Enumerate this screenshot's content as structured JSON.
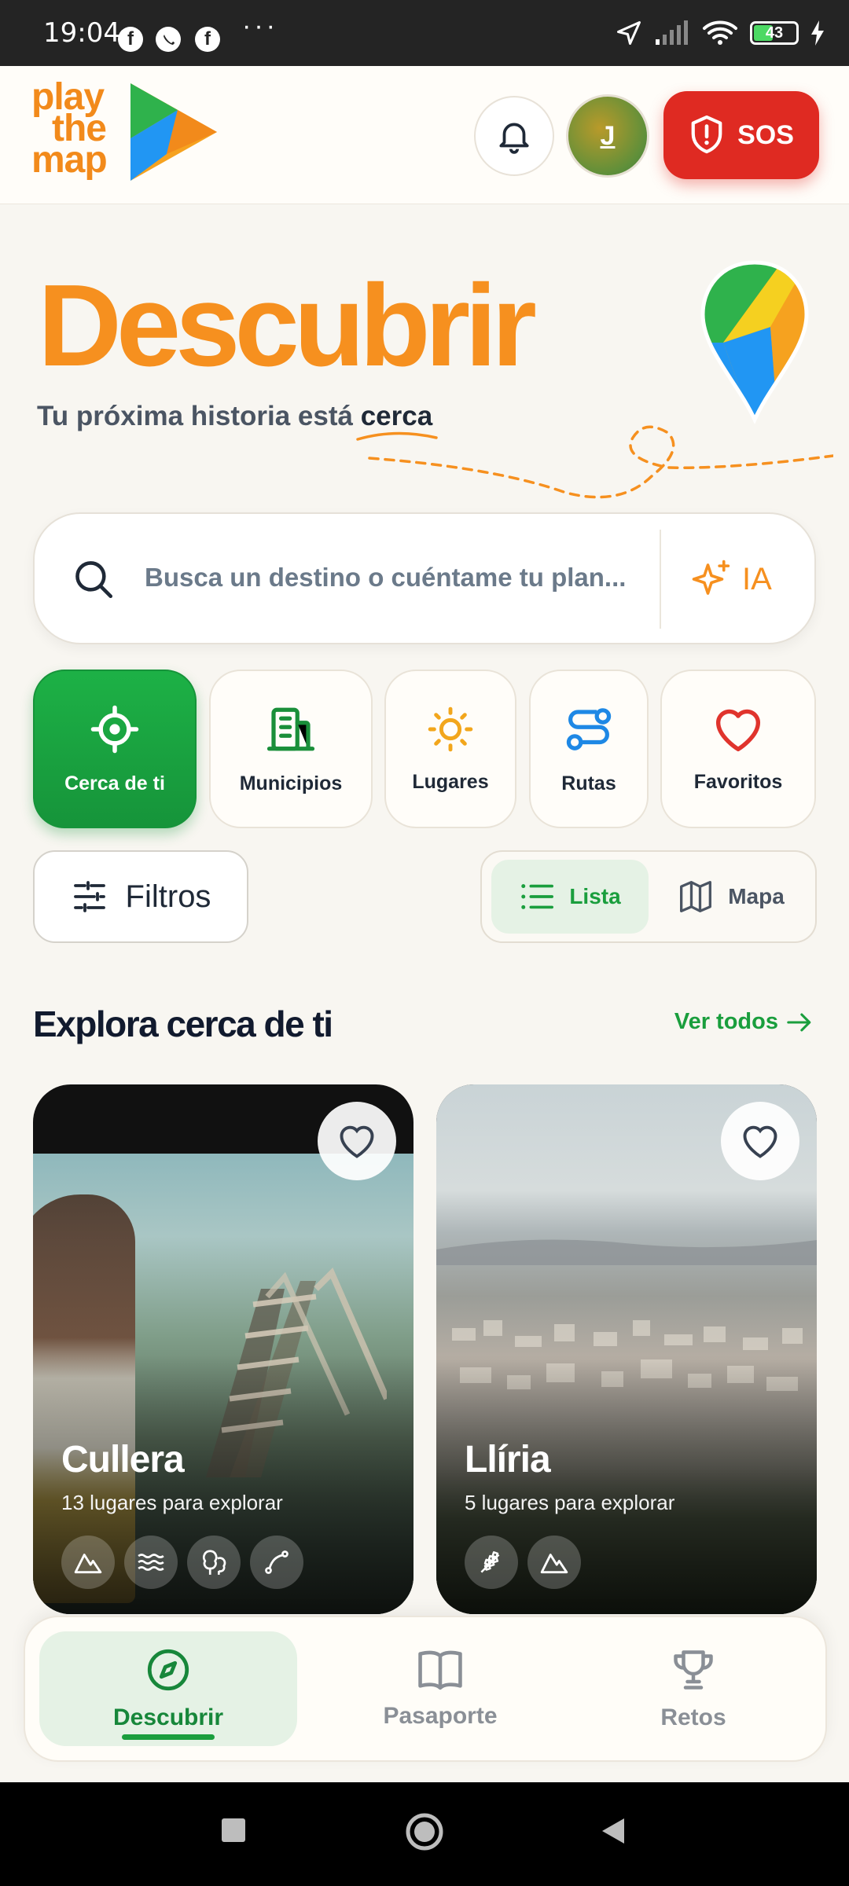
{
  "status_bar": {
    "time": "19:04",
    "battery": "43",
    "apps": [
      "facebook-icon",
      "whatsapp-icon",
      "facebook-icon"
    ],
    "more": "···"
  },
  "header": {
    "logo_lines": [
      "play",
      "the",
      "map"
    ],
    "avatar_initial": "J",
    "sos_label": "SOS"
  },
  "hero": {
    "title": "Descubrir",
    "subtitle_prefix": "Tu próxima historia está ",
    "subtitle_accent": "cerca"
  },
  "search": {
    "placeholder": "Busca un destino o cuéntame tu plan...",
    "ai_label": "IA"
  },
  "categories": [
    {
      "label": "Cerca de ti",
      "icon": "target-icon",
      "active": true
    },
    {
      "label": "Municipios",
      "icon": "building-icon",
      "active": false
    },
    {
      "label": "Lugares",
      "icon": "sun-icon",
      "active": false
    },
    {
      "label": "Rutas",
      "icon": "route-icon",
      "active": false
    },
    {
      "label": "Favoritos",
      "icon": "heart-icon",
      "active": false
    }
  ],
  "filters": {
    "label": "Filtros"
  },
  "view_toggle": {
    "list_label": "Lista",
    "map_label": "Mapa",
    "selected": "Lista"
  },
  "section": {
    "title": "Explora cerca de ti",
    "see_all": "Ver todos"
  },
  "cards": [
    {
      "title": "Cullera",
      "subtitle": "13 lugares para explorar",
      "tags": [
        "mountain-icon",
        "waves-icon",
        "trees-icon",
        "route-icon"
      ]
    },
    {
      "title": "Llíria",
      "subtitle": "5 lugares para explorar",
      "tags": [
        "wheat-icon",
        "mountain-icon"
      ]
    }
  ],
  "bottom_nav": [
    {
      "label": "Descubrir",
      "icon": "compass-icon",
      "active": true
    },
    {
      "label": "Pasaporte",
      "icon": "book-icon",
      "active": false
    },
    {
      "label": "Retos",
      "icon": "trophy-icon",
      "active": false
    }
  ],
  "colors": {
    "brand_orange": "#f6901f",
    "brand_green": "#1a9e3d",
    "sos_red": "#df2a22"
  }
}
